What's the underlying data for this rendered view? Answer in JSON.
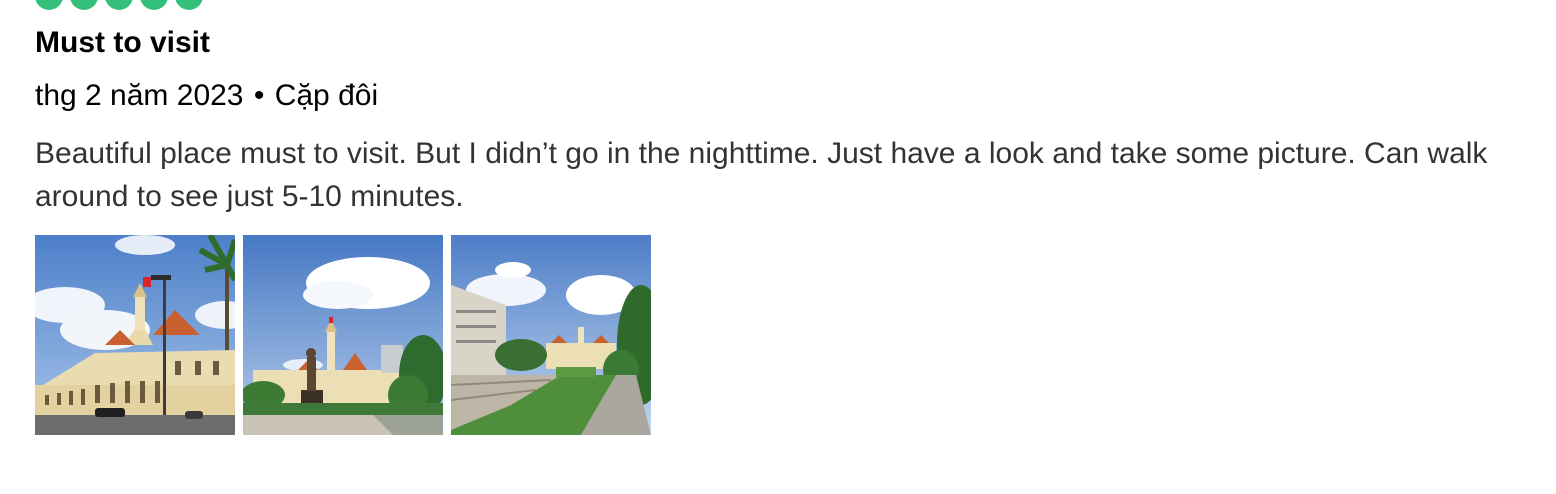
{
  "review": {
    "rating": {
      "value": 5,
      "max": 5,
      "bubble_color": "#34c07a"
    },
    "title": "Must to visit",
    "date": "thg 2 năm 2023",
    "separator": "•",
    "trip_type": "Cặp đôi",
    "text": "Beautiful place must to visit. But I didn’t go in the nighttime. Just have a look and take some picture. Can walk around to see just 5-10 minutes.",
    "photos": [
      {
        "subject": "city-hall-building-photo"
      },
      {
        "subject": "statue-and-city-hall-photo"
      },
      {
        "subject": "garden-path-photo"
      }
    ]
  }
}
